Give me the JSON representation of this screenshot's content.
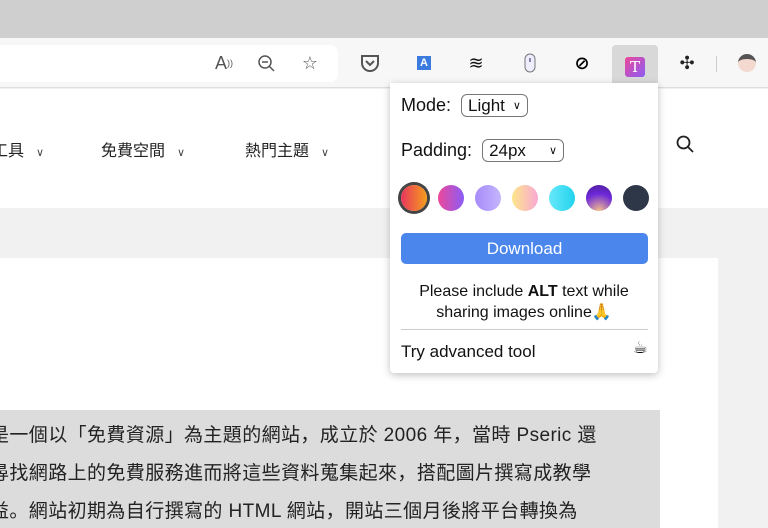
{
  "toolbar": {
    "icons": [
      "read-aloud-icon",
      "zoom-out-icon",
      "add-favorite-icon",
      "pocket-icon",
      "translate-icon",
      "layers-icon",
      "mouse-icon",
      "block-icon",
      "text-t-icon",
      "extensions-icon",
      "profile-avatar"
    ]
  },
  "nav": {
    "items": [
      {
        "label": "工具"
      },
      {
        "label": "免費空間"
      },
      {
        "label": "熱門主題"
      }
    ]
  },
  "content": {
    "lines": [
      "是一個以「免費資源」為主題的網站，成立於 2006 年，當時 Pseric 還",
      "尋找網路上的免費服務進而將這些資料蒐集起來，搭配圖片撰寫成教學",
      "益。網站初期為自行撰寫的 HTML 網站，開站三個月後將平台轉換為"
    ]
  },
  "popup": {
    "mode_label": "Mode:",
    "mode_value": "Light",
    "padding_label": "Padding:",
    "padding_value": "24px",
    "swatches": [
      {
        "name": "red-orange",
        "bg": "linear-gradient(90deg,#e8365d,#f59e1c)",
        "selected": true
      },
      {
        "name": "pink-purple",
        "bg": "linear-gradient(90deg,#ec4899,#8b5cf6)"
      },
      {
        "name": "lavender",
        "bg": "linear-gradient(90deg,#a78bfa,#c4b5fd)"
      },
      {
        "name": "peach-pink",
        "bg": "linear-gradient(90deg,#fde68a,#f9a8d4)"
      },
      {
        "name": "cyan",
        "bg": "linear-gradient(90deg,#67e8f9,#22d3ee)"
      },
      {
        "name": "indigo-glow",
        "bg": "radial-gradient(circle at 50% 100%,#f5c08a,#6d28d9 60%,#4c1d95)"
      },
      {
        "name": "slate",
        "bg": "#2d3748"
      }
    ],
    "download_label": "Download",
    "note_pre": "Please include ",
    "note_bold": "ALT",
    "note_post": " text while",
    "note_line2": "sharing images online🙏",
    "advanced_label": "Try advanced tool",
    "advanced_icon": "☕"
  }
}
